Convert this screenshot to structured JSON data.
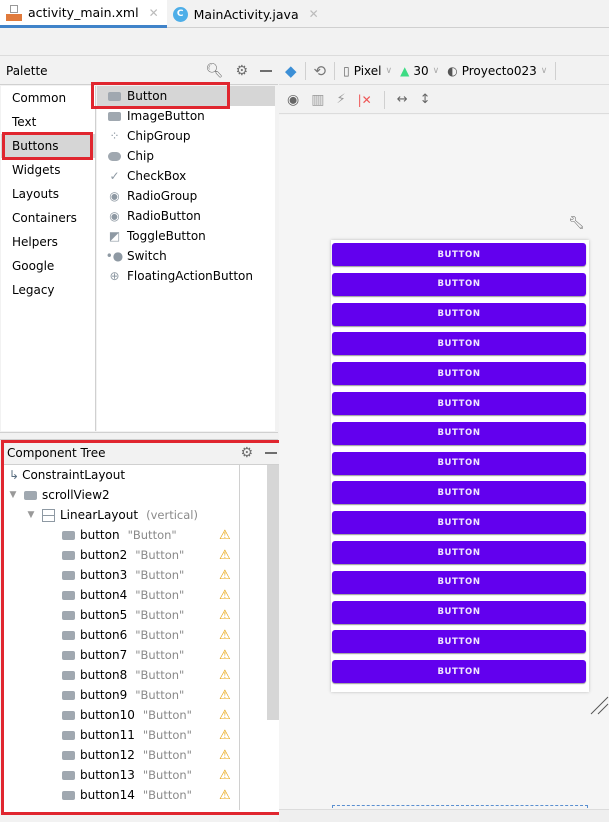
{
  "tabs": [
    {
      "label": "activity_main.xml",
      "icon": "xml-layout-icon",
      "active": true
    },
    {
      "label": "MainActivity.java",
      "icon": "java-class-icon",
      "active": false
    }
  ],
  "palette": {
    "title": "Palette",
    "categories": [
      "Common",
      "Text",
      "Buttons",
      "Widgets",
      "Layouts",
      "Containers",
      "Helpers",
      "Google",
      "Legacy"
    ],
    "selected_category": "Buttons",
    "widgets": [
      {
        "label": "Button",
        "icon": "button-icon"
      },
      {
        "label": "ImageButton",
        "icon": "image-button-icon"
      },
      {
        "label": "ChipGroup",
        "icon": "chip-group-icon"
      },
      {
        "label": "Chip",
        "icon": "chip-icon"
      },
      {
        "label": "CheckBox",
        "icon": "checkmark-icon"
      },
      {
        "label": "RadioGroup",
        "icon": "radio-icon"
      },
      {
        "label": "RadioButton",
        "icon": "radio-icon"
      },
      {
        "label": "ToggleButton",
        "icon": "toggle-icon"
      },
      {
        "label": "Switch",
        "icon": "switch-icon"
      },
      {
        "label": "FloatingActionButton",
        "icon": "plus-circle-icon"
      }
    ],
    "selected_widget": "Button"
  },
  "design_toolbar": {
    "device": "Pixel",
    "api_level": "30",
    "theme": "Proyecto023"
  },
  "component_tree": {
    "title": "Component Tree",
    "root": "ConstraintLayout",
    "scroll": "scrollView2",
    "linear": "LinearLayout",
    "linear_orientation": "(vertical)",
    "buttons": [
      {
        "id": "button",
        "text": "\"Button\""
      },
      {
        "id": "button2",
        "text": "\"Button\""
      },
      {
        "id": "button3",
        "text": "\"Button\""
      },
      {
        "id": "button4",
        "text": "\"Button\""
      },
      {
        "id": "button5",
        "text": "\"Button\""
      },
      {
        "id": "button6",
        "text": "\"Button\""
      },
      {
        "id": "button7",
        "text": "\"Button\""
      },
      {
        "id": "button8",
        "text": "\"Button\""
      },
      {
        "id": "button9",
        "text": "\"Button\""
      },
      {
        "id": "button10",
        "text": "\"Button\""
      },
      {
        "id": "button11",
        "text": "\"Button\""
      },
      {
        "id": "button12",
        "text": "\"Button\""
      },
      {
        "id": "button13",
        "text": "\"Button\""
      },
      {
        "id": "button14",
        "text": "\"Button\""
      }
    ]
  },
  "preview": {
    "button_label": "BUTTON",
    "button_count": 15,
    "button_color": "#6200ee"
  }
}
